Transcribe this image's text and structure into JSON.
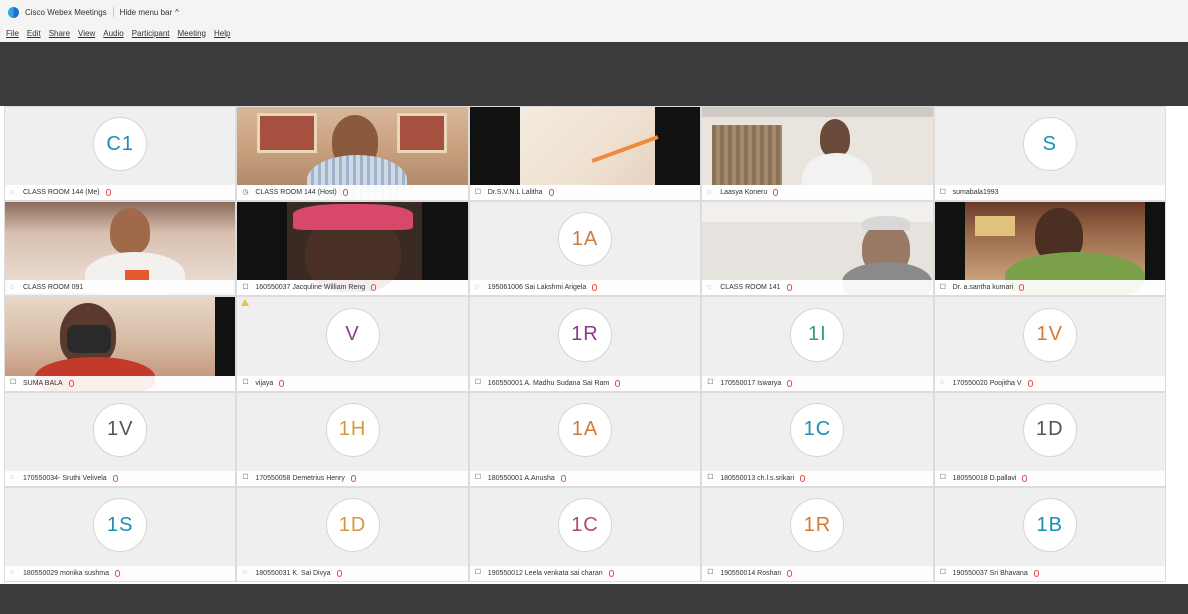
{
  "window": {
    "app_title": "Cisco Webex Meetings",
    "hide_menu_label": "Hide menu bar",
    "hide_menu_icon": "chevron-up-icon"
  },
  "menu": [
    "File",
    "Edit",
    "Share",
    "View",
    "Audio",
    "Participant",
    "Meeting",
    "Help"
  ],
  "participants": [
    {
      "name": "CLASS ROOM 144 (Me)",
      "avatar": "C1",
      "avatar_color": "#1a8fb5",
      "icon": "phone-icon",
      "mic": true
    },
    {
      "name": "CLASS ROOM 144 (Host)",
      "video": "host",
      "icon": "host-icon",
      "mic": true
    },
    {
      "name": "Dr.S.V.N.L Lalitha",
      "video": "room-light",
      "icon": "video-icon",
      "mic": true
    },
    {
      "name": "Laasya Koneru",
      "video": "curtain",
      "icon": "phone-icon",
      "mic": true
    },
    {
      "name": "sumabala1993",
      "avatar": "S",
      "avatar_color": "#1a8fb5",
      "icon": "video-icon",
      "mic": false
    },
    {
      "name": "CLASS ROOM 091",
      "video": "class091",
      "icon": "phone-icon",
      "mic": false,
      "selected": true
    },
    {
      "name": "160550037 Jacquline William Reng",
      "video": "jacquline",
      "icon": "video-icon",
      "mic": true
    },
    {
      "name": "195061006 Sai Lakshmi Arigela",
      "avatar": "1A",
      "avatar_color": "#d07b3a",
      "icon": "phone-icon",
      "mic": true
    },
    {
      "name": "CLASS ROOM 141",
      "video": "class141",
      "icon": "phone-icon",
      "mic": true
    },
    {
      "name": "Dr. a.santha kumari",
      "video": "santha",
      "icon": "video-icon",
      "mic": true
    },
    {
      "name": "SUMA BALA",
      "video": "suma",
      "icon": "video-icon",
      "mic": true
    },
    {
      "name": "vijaya",
      "avatar": "V",
      "avatar_color": "#8a3b8f",
      "icon": "video-icon",
      "mic": true,
      "warning": true
    },
    {
      "name": "160550001 A. Madhu Sudana Sai Ram",
      "avatar": "1R",
      "avatar_color": "#8a3b8f",
      "icon": "video-icon",
      "mic": true
    },
    {
      "name": "170550017 Iswarya",
      "avatar": "1I",
      "avatar_color": "#2f9a8a",
      "icon": "video-icon",
      "mic": true
    },
    {
      "name": "170550020 Poojitha V",
      "avatar": "1V",
      "avatar_color": "#d07b3a",
      "icon": "phone-icon",
      "mic": true
    },
    {
      "name": "170550034- Sruthi Velivela",
      "avatar": "1V",
      "avatar_color": "#555555",
      "icon": "phone-icon",
      "mic": true
    },
    {
      "name": "170550058 Demetrius Henry",
      "avatar": "1H",
      "avatar_color": "#d49a3a",
      "icon": "video-icon",
      "mic": true
    },
    {
      "name": "180550001 A.Anusha",
      "avatar": "1A",
      "avatar_color": "#d07b3a",
      "icon": "video-icon",
      "mic": true
    },
    {
      "name": "180550013 ch.l.s.srikari",
      "avatar": "1C",
      "avatar_color": "#1a8fb5",
      "icon": "video-icon",
      "mic": true
    },
    {
      "name": "180550018 D.pallavi",
      "avatar": "1D",
      "avatar_color": "#555555",
      "icon": "video-icon",
      "mic": true
    },
    {
      "name": "180550029 monika sushma",
      "avatar": "1S",
      "avatar_color": "#1a8fb5",
      "icon": "phone-icon",
      "mic": true
    },
    {
      "name": "180550031 K. Sai Divya",
      "avatar": "1D",
      "avatar_color": "#d49a3a",
      "icon": "phone-icon",
      "mic": true
    },
    {
      "name": "190550012 Leela venkata sai charan",
      "avatar": "1C",
      "avatar_color": "#b04a70",
      "icon": "video-icon",
      "mic": true
    },
    {
      "name": "190550014 Roshan",
      "avatar": "1R",
      "avatar_color": "#d07b3a",
      "icon": "video-icon",
      "mic": true
    },
    {
      "name": "190550037 Sri Bhavana",
      "avatar": "1B",
      "avatar_color": "#1a8fb5",
      "icon": "video-icon",
      "mic": true
    }
  ]
}
